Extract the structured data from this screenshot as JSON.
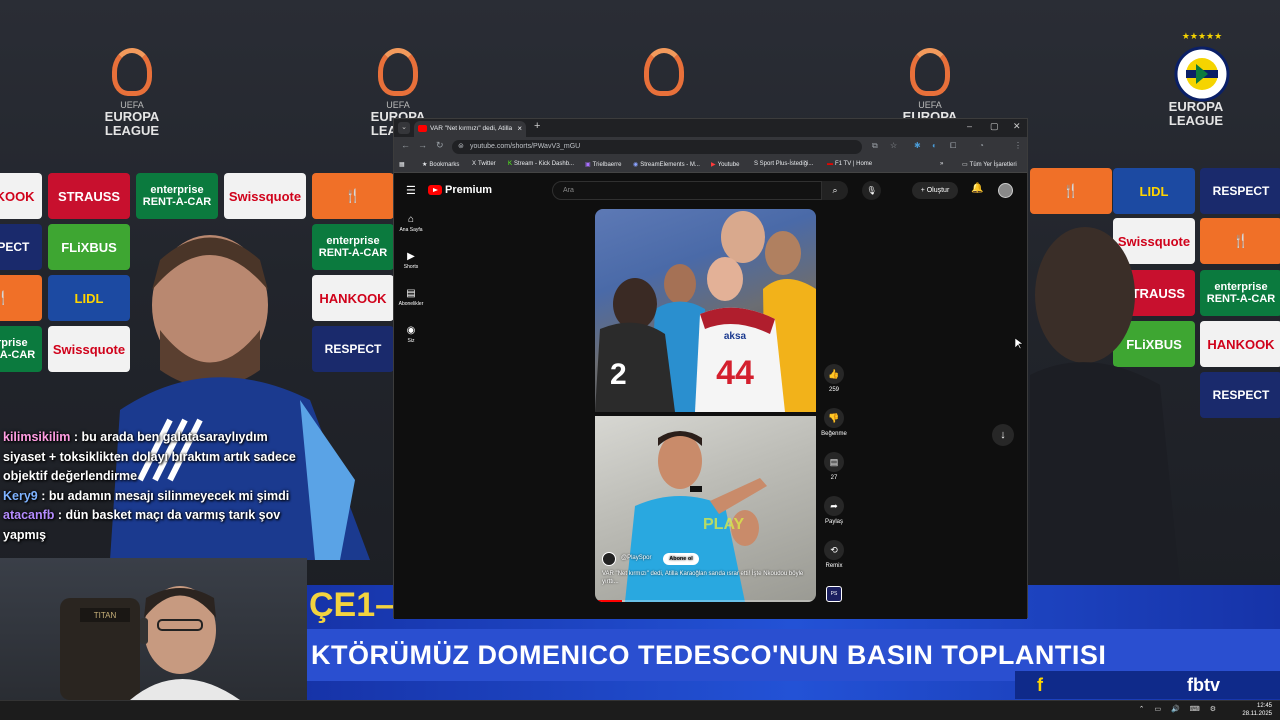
{
  "background": {
    "europa_league_logo": {
      "line1": "UEFA",
      "line2": "EUROPA",
      "line3": "LEAGUE"
    },
    "sponsors": [
      "HANKOOK",
      "STRAUSS",
      "enterprise RENT-A-CAR",
      "Swissquote",
      "FLiXBUS",
      "LIDL",
      "RESPECT"
    ],
    "club_crest": "FENERBAHÇE SPOR KULÜBÜ 1907",
    "banner": {
      "top_text": "ÇE1–",
      "headline": "KTÖRÜMÜZ DOMENICO TEDESCO'NUN BASIN TOPLANTISI",
      "social_icon": "f",
      "channel": "fbtv"
    }
  },
  "chat": [
    {
      "user": "kilimsikilim",
      "text": ": bu arada ben galatasaraylıydım siyaset + toksiklikten dolayı bıraktım artık sadece objektif değerlendirme"
    },
    {
      "user": "Kery9",
      "text": ": bu adamın mesajı silinmeyecek mi şimdi"
    },
    {
      "user": "atacanfb",
      "text": ": dün basket maçı da varmış tarık şov yapmış"
    }
  ],
  "browser": {
    "tab_title": "VAR \"Net kırmızı\" dedi, Atilla",
    "tab_close": "×",
    "new_tab": "+",
    "url": "youtube.com/shorts/PWavV3_mGU",
    "window_controls": [
      "–",
      "▢",
      "✕"
    ],
    "bookmarks": [
      "Bookmarks",
      "Twitter",
      "Stream - Kick Dashb...",
      "Trielbaerre",
      "StreamElements - M...",
      "Youtube",
      "S Sport Plus-İstediği...",
      "F1 TV | Home"
    ],
    "bookmarks_overflow": "»",
    "all_bookmarks": "Tüm Yer İşaretleri"
  },
  "youtube": {
    "brand": "Premium",
    "search_placeholder": "Ara",
    "create_label": "+ Oluştur",
    "sidebar": [
      {
        "icon": "home-icon",
        "glyph": "⌂",
        "label": "Ana Sayfa"
      },
      {
        "icon": "shorts-icon",
        "glyph": "▶",
        "label": "Shorts"
      },
      {
        "icon": "subscriptions-icon",
        "glyph": "▤",
        "label": "Abonelikler"
      },
      {
        "icon": "you-icon",
        "glyph": "◉",
        "label": "Siz"
      }
    ],
    "short": {
      "channel_name": "@PlaySpor",
      "subscribe_label": "Abone ol",
      "title": "VAR \"Net kırmızı\" dedi, Atilla Karaoğlan sarıda ısrar etti! İşte Nkoudou böyle yırttı...",
      "jersey_number": "44",
      "jersey_sponsor": "aksa",
      "progress": 0.12
    },
    "actions": {
      "like_count": "259",
      "dislike_label": "Beğenme",
      "comment_count": "27",
      "share_label": "Paylaş",
      "remix_label": "Remix",
      "channel_thumb": "PS"
    }
  },
  "taskbar": {
    "time": "12:45",
    "date": "28.11.2025"
  }
}
